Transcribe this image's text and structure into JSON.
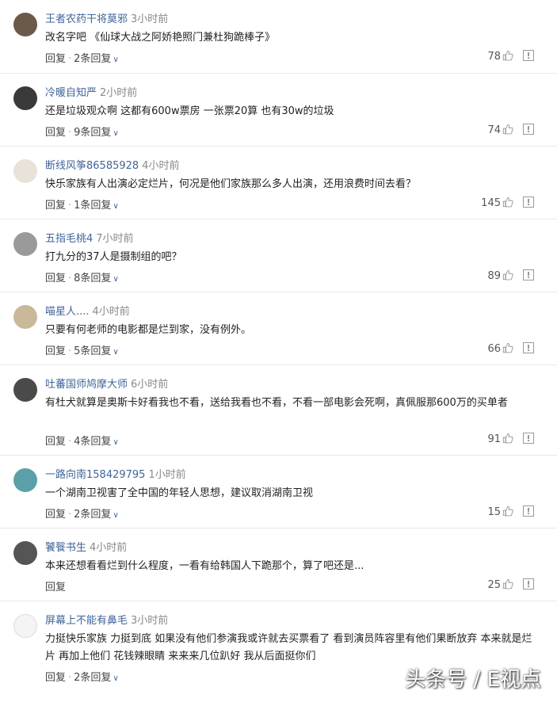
{
  "labels": {
    "reply": "回复",
    "dot": "·"
  },
  "watermark": "头条号 / E视点",
  "comments": [
    {
      "user": "王者农药干将莫邪",
      "time": "3小时前",
      "text": "改名字吧 《仙球大战之阿娇艳照门兼杜狗跪棒子》",
      "replies": "2条回复",
      "likes": "78",
      "avatar_color": "#6b5a4a"
    },
    {
      "user": "冷暖自知严",
      "time": "2小时前",
      "text": "还是垃圾观众啊 这都有600w票房 一张票20算 也有30w的垃圾",
      "replies": "9条回复",
      "likes": "74",
      "avatar_color": "#3a3a3a"
    },
    {
      "user": "断线风筝86585928",
      "time": "4小时前",
      "text": "快乐家族有人出演必定烂片，何况是他们家族那么多人出演，还用浪费时间去看？",
      "replies": "1条回复",
      "likes": "145",
      "avatar_color": "#e9e2d8"
    },
    {
      "user": "五指毛桃4",
      "time": "7小时前",
      "text": "打九分的37人是摄制组的吧？",
      "replies": "8条回复",
      "likes": "89",
      "avatar_color": "#9a9a9a"
    },
    {
      "user": "喵星人....",
      "time": "4小时前",
      "text": "只要有何老师的电影都是烂到家，没有例外。",
      "replies": "5条回复",
      "likes": "66",
      "avatar_color": "#c9b89a"
    },
    {
      "user": "吐蕃国师鸠摩大师",
      "time": "6小时前",
      "text": "有杜犬就算是奥斯卡好看我也不看，送给我看也不看，不看一部电影会死啊，真佩服那600万的买单者",
      "replies": "4条回复",
      "likes": "91",
      "avatar_color": "#4a4a4a"
    },
    {
      "user": "一路向南158429795",
      "time": "1小时前",
      "text": "一个湖南卫视害了全中国的年轻人思想，建议取消湖南卫视",
      "replies": "2条回复",
      "likes": "15",
      "avatar_color": "#5aa0a8"
    },
    {
      "user": "饕餮书生",
      "time": "4小时前",
      "text": "本来还想看看烂到什么程度，一看有给韩国人下跪那个，算了吧还是...",
      "replies": "",
      "likes": "25",
      "avatar_color": "#555555"
    },
    {
      "user": "屏幕上不能有鼻毛",
      "time": "3小时前",
      "text": "力挺快乐家族 力挺到底 如果没有他们参演我或许就去买票看了 看到演员阵容里有他们果断放弃 本来就是烂片 再加上他们 花钱辣眼睛 来来来几位趴好 我从后面挺你们",
      "replies": "2条回复",
      "likes": "",
      "avatar_color": "#f4f4f4"
    }
  ]
}
